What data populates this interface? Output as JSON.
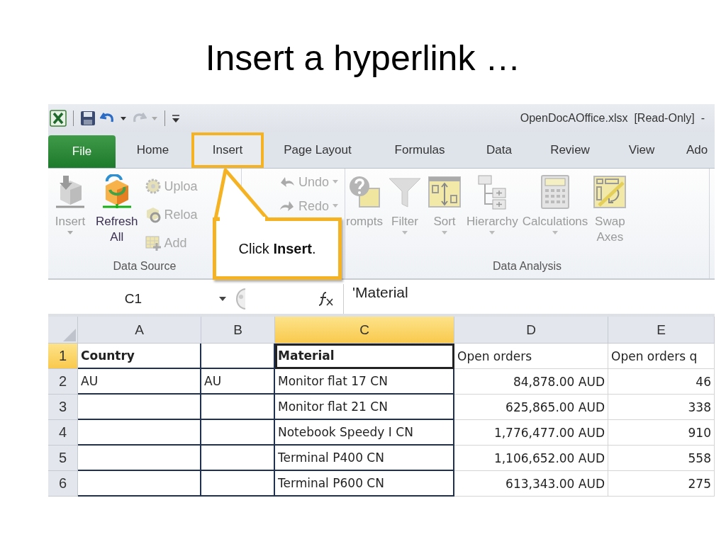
{
  "slide_title": "Insert a hyperlink …",
  "window": {
    "title": "OpenDocAOffice.xlsx  [Read-Only]  -"
  },
  "tabs": [
    {
      "label": "File",
      "kind": "file",
      "selected": false
    },
    {
      "label": "Home",
      "kind": "tab",
      "selected": false
    },
    {
      "label": "Insert",
      "kind": "tab",
      "selected": true
    },
    {
      "label": "Page Layout",
      "kind": "tab",
      "selected": false
    },
    {
      "label": "Formulas",
      "kind": "tab",
      "selected": false
    },
    {
      "label": "Data",
      "kind": "tab",
      "selected": false
    },
    {
      "label": "Review",
      "kind": "tab",
      "selected": false
    },
    {
      "label": "View",
      "kind": "tab",
      "selected": false
    },
    {
      "label": "Ado",
      "kind": "tab",
      "selected": false
    }
  ],
  "ribbon": {
    "groups": [
      {
        "label": "Data Source",
        "large": [
          {
            "label": "Insert",
            "disabled": true,
            "dropdown": true
          },
          {
            "label": "Refresh All",
            "disabled": false,
            "dropdown": false
          }
        ],
        "small": [
          {
            "label": "Uploa",
            "disabled": true,
            "dropdown": false
          },
          {
            "label": "Reloa",
            "disabled": true,
            "dropdown": false
          },
          {
            "label": "Add",
            "disabled": true,
            "dropdown": false
          }
        ]
      },
      {
        "small": [
          {
            "label": "Undo",
            "disabled": true,
            "dropdown": true
          },
          {
            "label": "Redo",
            "disabled": true,
            "dropdown": true
          }
        ]
      },
      {
        "label": "Data Analysis",
        "large": [
          {
            "label": "rompts",
            "disabled": true,
            "dropdown": false
          },
          {
            "label": "Filter",
            "disabled": true,
            "dropdown": true
          },
          {
            "label": "Sort",
            "disabled": true,
            "dropdown": true
          },
          {
            "label": "Hierarchy",
            "disabled": true,
            "dropdown": true
          },
          {
            "label": "Calculations",
            "disabled": true,
            "dropdown": true
          },
          {
            "label": "Swap Axes",
            "disabled": true,
            "dropdown": false
          }
        ]
      }
    ]
  },
  "callout": {
    "text": "Click **Insert**."
  },
  "formula_bar": {
    "name_box": "C1",
    "formula": "'Material"
  },
  "sheet": {
    "columns": [
      {
        "label": "A",
        "selected": false
      },
      {
        "label": "B",
        "selected": false
      },
      {
        "label": "C",
        "selected": true
      },
      {
        "label": "D",
        "selected": false
      },
      {
        "label": "E",
        "selected": false
      }
    ],
    "rows": [
      {
        "number": "1",
        "selected": true,
        "cells": [
          {
            "text": "Country",
            "bold": true,
            "active": false
          },
          null,
          {
            "text": "Material",
            "bold": true,
            "active": true
          },
          {
            "text": "Open orders",
            "bold": false,
            "active": false
          },
          {
            "text": "Open orders q",
            "bold": false,
            "active": false
          }
        ]
      },
      {
        "number": "2",
        "selected": false,
        "cells": [
          {
            "text": "AU",
            "bold": false,
            "active": false
          },
          {
            "text": "AU",
            "bold": false,
            "active": false
          },
          {
            "text": "Monitor flat 17 CN",
            "bold": false,
            "active": false
          },
          {
            "text": "84,878.00 AUD",
            "bold": false,
            "active": false
          },
          {
            "text": "46",
            "bold": false,
            "active": false
          }
        ]
      },
      {
        "number": "3",
        "selected": false,
        "cells": [
          null,
          null,
          {
            "text": "Monitor flat 21 CN",
            "bold": false,
            "active": false
          },
          {
            "text": "625,865.00 AUD",
            "bold": false,
            "active": false
          },
          {
            "text": "338",
            "bold": false,
            "active": false
          }
        ]
      },
      {
        "number": "4",
        "selected": false,
        "cells": [
          null,
          null,
          {
            "text": "Notebook Speedy I CN",
            "bold": false,
            "active": false
          },
          {
            "text": "1,776,477.00 AUD",
            "bold": false,
            "active": false
          },
          {
            "text": "910",
            "bold": false,
            "active": false
          }
        ]
      },
      {
        "number": "5",
        "selected": false,
        "cells": [
          null,
          null,
          {
            "text": "Terminal P400 CN",
            "bold": false,
            "active": false
          },
          {
            "text": "1,106,652.00 AUD",
            "bold": false,
            "active": false
          },
          {
            "text": "558",
            "bold": false,
            "active": false
          }
        ]
      },
      {
        "number": "6",
        "selected": false,
        "cells": [
          null,
          null,
          {
            "text": "Terminal P600 CN",
            "bold": false,
            "active": false
          },
          {
            "text": "613,343.00 AUD",
            "bold": false,
            "active": false
          },
          {
            "text": "275",
            "bold": false,
            "active": false
          }
        ]
      }
    ]
  }
}
